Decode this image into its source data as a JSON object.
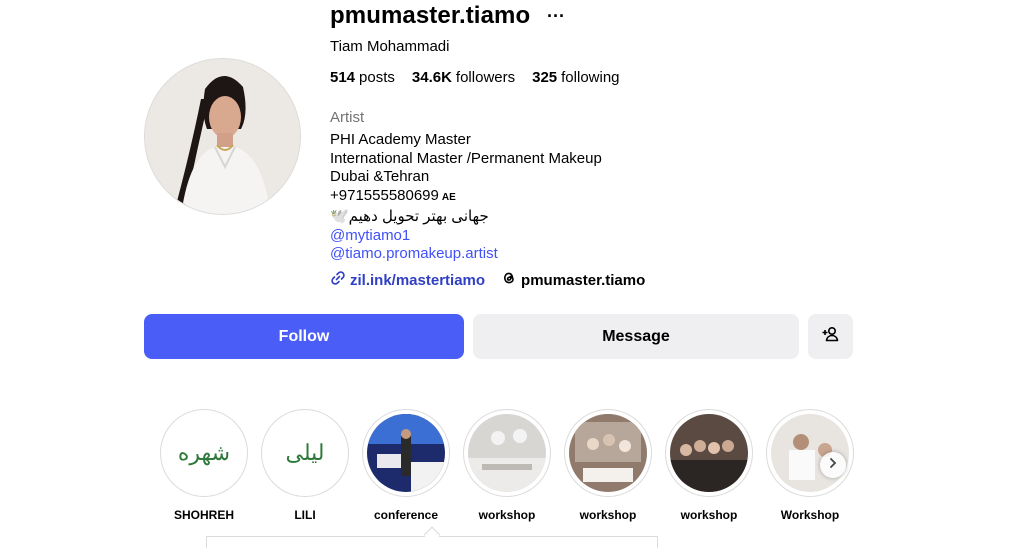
{
  "profile": {
    "username": "pmumaster.tiamo",
    "more_icon": "···",
    "full_name": "Tiam Mohammadi",
    "stats": [
      {
        "count": "514",
        "label": "posts"
      },
      {
        "count": "34.6K",
        "label": "followers"
      },
      {
        "count": "325",
        "label": "following"
      }
    ],
    "category": "Artist",
    "bio_lines": [
      "PHI Academy Master",
      "International Master /Permanent Makeup",
      "Dubai &Tehran",
      "+971555580699"
    ],
    "bio_flag": "AE",
    "bio_persian": "جهانی بهتر تحویل دهیم🕊️",
    "mentions": [
      "@mytiamo1",
      "@tiamo.promakeup.artist"
    ],
    "external_link": "zil.ink/mastertiamo",
    "threads_handle": "pmumaster.tiamo"
  },
  "actions": {
    "follow": "Follow",
    "message": "Message"
  },
  "highlights": [
    {
      "label": "SHOHREH",
      "kind": "calligraphy",
      "glyph": "شهره"
    },
    {
      "label": "LILI",
      "kind": "calligraphy",
      "glyph": "لیلی"
    },
    {
      "label": "conference",
      "kind": "photo"
    },
    {
      "label": "workshop",
      "kind": "photo"
    },
    {
      "label": "workshop",
      "kind": "photo"
    },
    {
      "label": "workshop",
      "kind": "photo"
    },
    {
      "label": "Workshop",
      "kind": "photo"
    }
  ],
  "icons": {
    "link": "link-icon",
    "threads": "threads-icon",
    "add_user": "add-user-icon",
    "next": "chevron-right-icon"
  },
  "colors": {
    "follow_button": "#4a5ef7",
    "link": "#303fc4",
    "mention": "#4150f7",
    "secondary_button": "#efeff2"
  }
}
